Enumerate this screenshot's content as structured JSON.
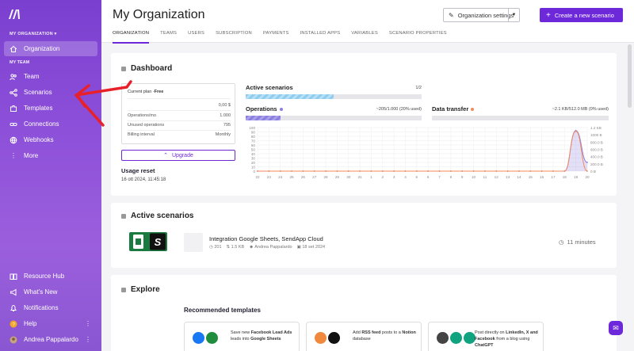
{
  "sidebar": {
    "org_label": "MY ORGANIZATION ▾",
    "team_label": "MY TEAM",
    "items_top": [
      {
        "label": "Organization",
        "icon": "home-icon",
        "active": true
      },
      {
        "label": "Team",
        "icon": "users-icon"
      },
      {
        "label": "Scenarios",
        "icon": "share-icon"
      },
      {
        "label": "Templates",
        "icon": "puzzle-icon"
      },
      {
        "label": "Connections",
        "icon": "link-icon"
      },
      {
        "label": "Webhooks",
        "icon": "globe-icon"
      },
      {
        "label": "More",
        "icon": "more-vertical-icon"
      }
    ],
    "items_bottom": [
      {
        "label": "Resource Hub",
        "icon": "book-icon"
      },
      {
        "label": "What's New",
        "icon": "megaphone-icon"
      },
      {
        "label": "Notifications",
        "icon": "bell-icon"
      },
      {
        "label": "Help",
        "icon": "help-icon"
      },
      {
        "label": "Andrea Pappalardo",
        "icon": "avatar-icon"
      }
    ]
  },
  "header": {
    "title": "My Organization",
    "settings_label": "Organization settings",
    "create_label": "Create a new scenario",
    "tabs": [
      "ORGANIZATION",
      "TEAMS",
      "USERS",
      "SUBSCRIPTION",
      "PAYMENTS",
      "INSTALLED APPS",
      "VARIABLES",
      "SCENARIO PROPERTIES"
    ]
  },
  "dashboard": {
    "title": "Dashboard",
    "plan": {
      "current_plan_label": "Current plan - ",
      "current_plan_value": "Free",
      "rows": [
        {
          "label": "",
          "value": "0,00 $"
        },
        {
          "label": "Operations/mo",
          "value": "1.000"
        },
        {
          "label": "Unused operations",
          "value": "795"
        },
        {
          "label": "Billing interval",
          "value": "Monthly"
        }
      ]
    },
    "upgrade_label": "Upgrade",
    "usage_reset_label": "Usage reset",
    "usage_reset_date": "16 ott 2024, 11:45:18",
    "active_scenarios": {
      "label": "Active scenarios",
      "value": "1/2",
      "fraction": 0.5
    },
    "operations": {
      "label": "Operations",
      "value": "~205/1.000 (20% used)",
      "fraction": 0.2
    },
    "data_transfer": {
      "label": "Data transfer",
      "value": "~2.1 KB/512.0 MB (0% used)",
      "fraction": 0.0
    },
    "colors": {
      "operations": "#8b7fe0",
      "data_transfer": "#f08a5d",
      "active_bar": "#8ecdf0"
    }
  },
  "chart_data": {
    "type": "area",
    "categories": [
      "22",
      "23",
      "24",
      "25",
      "26",
      "27",
      "28",
      "29",
      "30",
      "31",
      "1",
      "2",
      "3",
      "4",
      "5",
      "6",
      "7",
      "8",
      "9",
      "10",
      "11",
      "12",
      "13",
      "14",
      "15",
      "16",
      "17",
      "18",
      "19",
      "20"
    ],
    "series": [
      {
        "axis": "left",
        "color": "#8b7fe0",
        "values": [
          0,
          0,
          0,
          0,
          0,
          0,
          0,
          0,
          0,
          0,
          0,
          0,
          0,
          0,
          0,
          0,
          0,
          0,
          0,
          0,
          0,
          0,
          0,
          0,
          0,
          0,
          0,
          0,
          93,
          20
        ]
      },
      {
        "axis": "right",
        "color": "#f08a5d",
        "values": [
          0,
          0,
          0,
          0,
          0,
          0,
          0,
          0,
          0,
          0,
          0,
          0,
          0,
          0,
          0,
          0,
          0,
          0,
          0,
          0,
          0,
          0,
          0,
          0,
          0,
          0,
          0,
          0,
          1100,
          0
        ]
      }
    ],
    "y_left_ticks": [
      "100",
      "90",
      "80",
      "70",
      "60",
      "50",
      "40",
      "30",
      "20",
      "10",
      "0"
    ],
    "y_right_ticks": [
      "1.2 KB",
      "1000 B",
      "800.0 B",
      "600.0 B",
      "400.0 B",
      "200.0 B",
      "0 B"
    ],
    "ylim_left": [
      0,
      100
    ],
    "ylim_right": [
      0,
      1200
    ],
    "grid": true
  },
  "active_scenarios_card": {
    "title": "Active scenarios",
    "scenario_name": "Integration Google Sheets, SendApp Cloud",
    "meta_ops": "201",
    "meta_size": "1.5 KB",
    "meta_owner": "Andrea Pappalardo",
    "meta_date": "18 set 2024",
    "interval": "11 minutes"
  },
  "explore": {
    "title": "Explore",
    "recommended_title": "Recommended templates",
    "templates": [
      {
        "pre": "Save new ",
        "b1": "Facebook Lead Ads",
        "mid": " leads into ",
        "b2": "Google Sheets",
        "post": ""
      },
      {
        "pre": "Add ",
        "b1": "RSS feed",
        "mid": " posts to a ",
        "b2": "Notion",
        "post": " database"
      },
      {
        "pre": "Post directly on ",
        "b1": "LinkedIn, X and Facebook",
        "mid": " from a blog using ",
        "b2": "ChatGPT",
        "post": ""
      }
    ]
  }
}
